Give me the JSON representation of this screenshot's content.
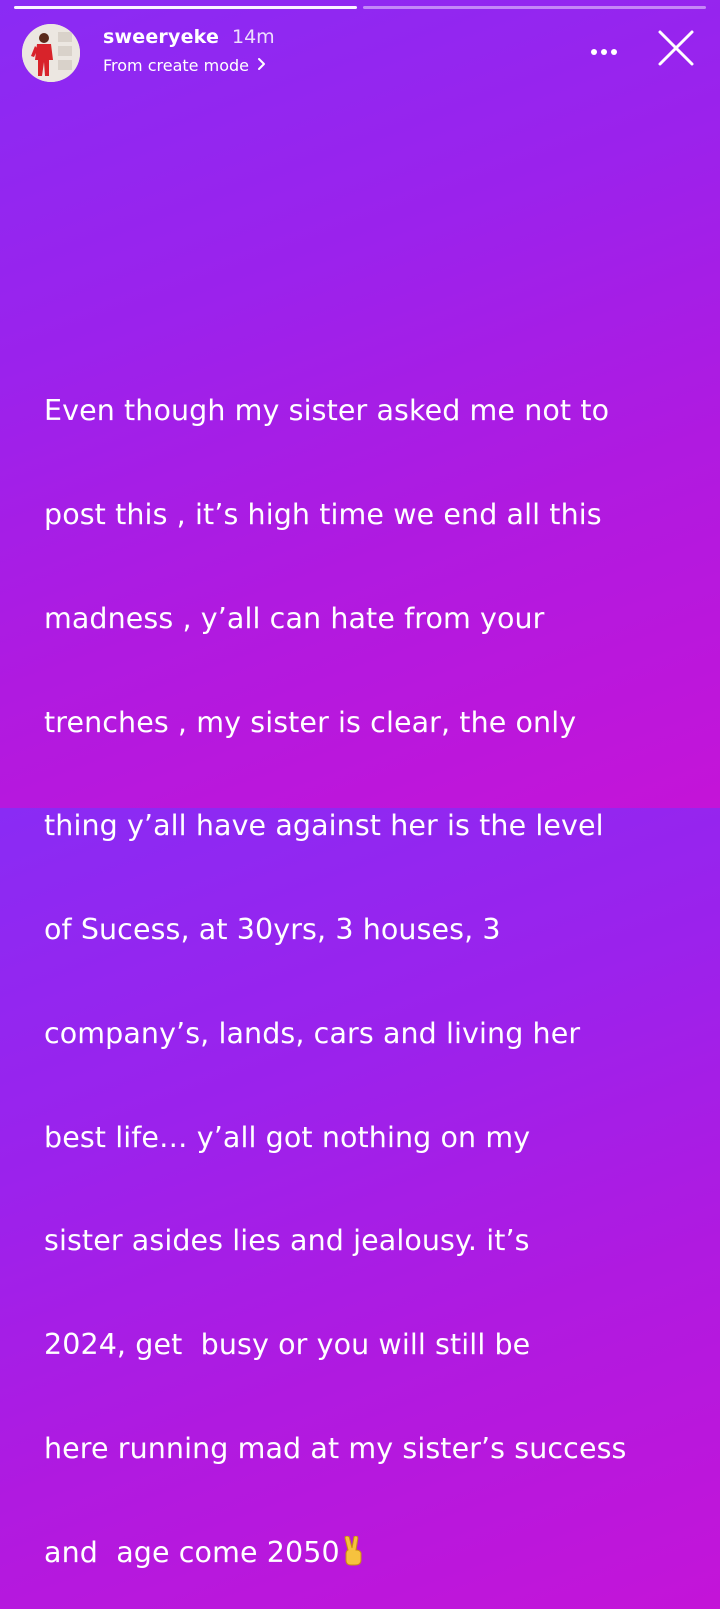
{
  "progress": {
    "segments": 2,
    "active_index": 0
  },
  "header": {
    "username": "sweeryeke",
    "time": "14m",
    "subline": "From create mode"
  },
  "icons": {
    "avatar": "profile-photo",
    "more": "more-horizontal-icon",
    "close": "close-icon",
    "subline_chevron": "chevron-right-icon",
    "emoji": "victory-hand-emoji"
  },
  "story": {
    "lines": [
      "Even though my sister asked me not to",
      "post this , it’s high time we end all this",
      "madness , y’all can hate from your",
      "trenches , my sister is clear, the only",
      "thing y’all have against her is the level",
      "of Sucess, at 30yrs, 3 houses, 3",
      "company’s, lands, cars and living her",
      "best life… y’all got nothing on my",
      "sister asides lies and jealousy. it’s",
      "2024, get  busy or you will still be",
      "here running mad at my sister’s success",
      "and  age come 2050"
    ]
  },
  "colors": {
    "gradient_start": "#8a2bf4",
    "gradient_end": "#c414d8",
    "text": "#ffffff"
  }
}
